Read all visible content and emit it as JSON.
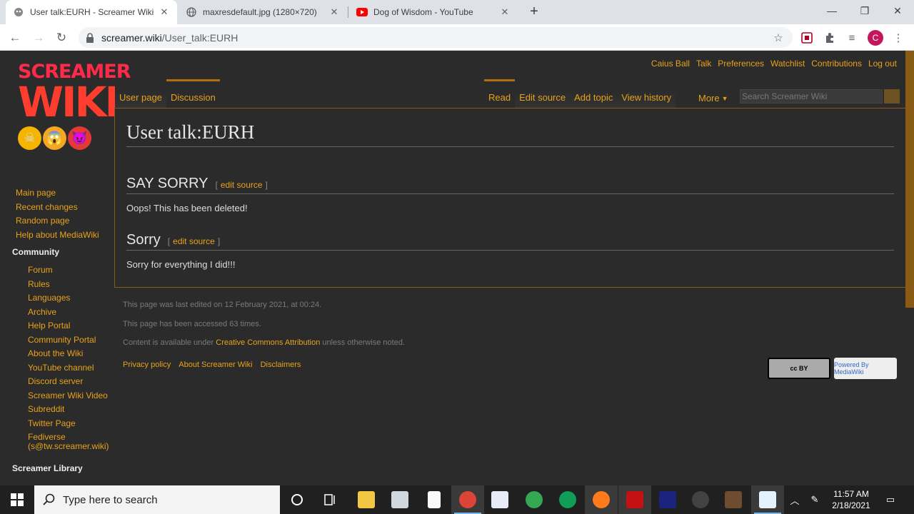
{
  "browser": {
    "tabs": [
      {
        "title": "User talk:EURH - Screamer Wiki",
        "icon": "screamer-favicon",
        "active": true
      },
      {
        "title": "maxresdefault.jpg (1280×720)",
        "icon": "globe-icon",
        "active": false
      },
      {
        "title": "Dog of Wisdom - YouTube",
        "icon": "youtube-icon",
        "active": false
      }
    ],
    "url_host": "screamer.wiki",
    "url_path": "/User_talk:EURH",
    "profile_initial": "C"
  },
  "wiki": {
    "logo_line1": "SCREAMER",
    "logo_line2": "WIKI",
    "personal_links": [
      "Caius Ball",
      "Talk",
      "Preferences",
      "Watchlist",
      "Contributions",
      "Log out"
    ],
    "namespace_tabs": [
      "User page",
      "Discussion"
    ],
    "view_tabs": [
      "Read",
      "Edit source",
      "Add topic",
      "View history"
    ],
    "more_label": "More",
    "search_placeholder": "Search Screamer Wiki",
    "page_title": "User talk:EURH",
    "sections": [
      {
        "heading": "SAY SORRY",
        "edit_label": "edit source",
        "text": "Oops! This has been deleted!"
      },
      {
        "heading": "Sorry",
        "edit_label": "edit source",
        "text": "Sorry for everything I did!!!"
      }
    ],
    "sidebar_nav": [
      "Main page",
      "Recent changes",
      "Random page",
      "Help about MediaWiki"
    ],
    "community_heading": "Community",
    "community_links": [
      "Forum",
      "Rules",
      "Languages",
      "Archive",
      "Help Portal",
      "Community Portal",
      "About the Wiki",
      "YouTube channel",
      "Discord server",
      "Screamer Wiki Video",
      "Subreddit",
      "Twitter Page"
    ],
    "fediverse_line1": "Fediverse",
    "fediverse_line2": "(s@tw.screamer.wiki)",
    "library_heading": "Screamer Library",
    "footer": {
      "last_edited": "This page was last edited on 12 February 2021, at 00:24.",
      "accessed": "This page has been accessed 63 times.",
      "license_prefix": "Content is available under ",
      "license_link": "Creative Commons Attribution",
      "license_suffix": " unless otherwise noted.",
      "links": [
        "Privacy policy",
        "About Screamer Wiki",
        "Disclaimers"
      ],
      "cc_badge": "cc BY",
      "mw_badge": "Powered By MediaWiki"
    }
  },
  "taskbar": {
    "search_placeholder": "Type here to search",
    "time": "11:57 AM",
    "date": "2/18/2021"
  },
  "colors": {
    "link": "#e8a21a",
    "background": "#2b2b2b",
    "logo_red": "#ff2a4a"
  }
}
